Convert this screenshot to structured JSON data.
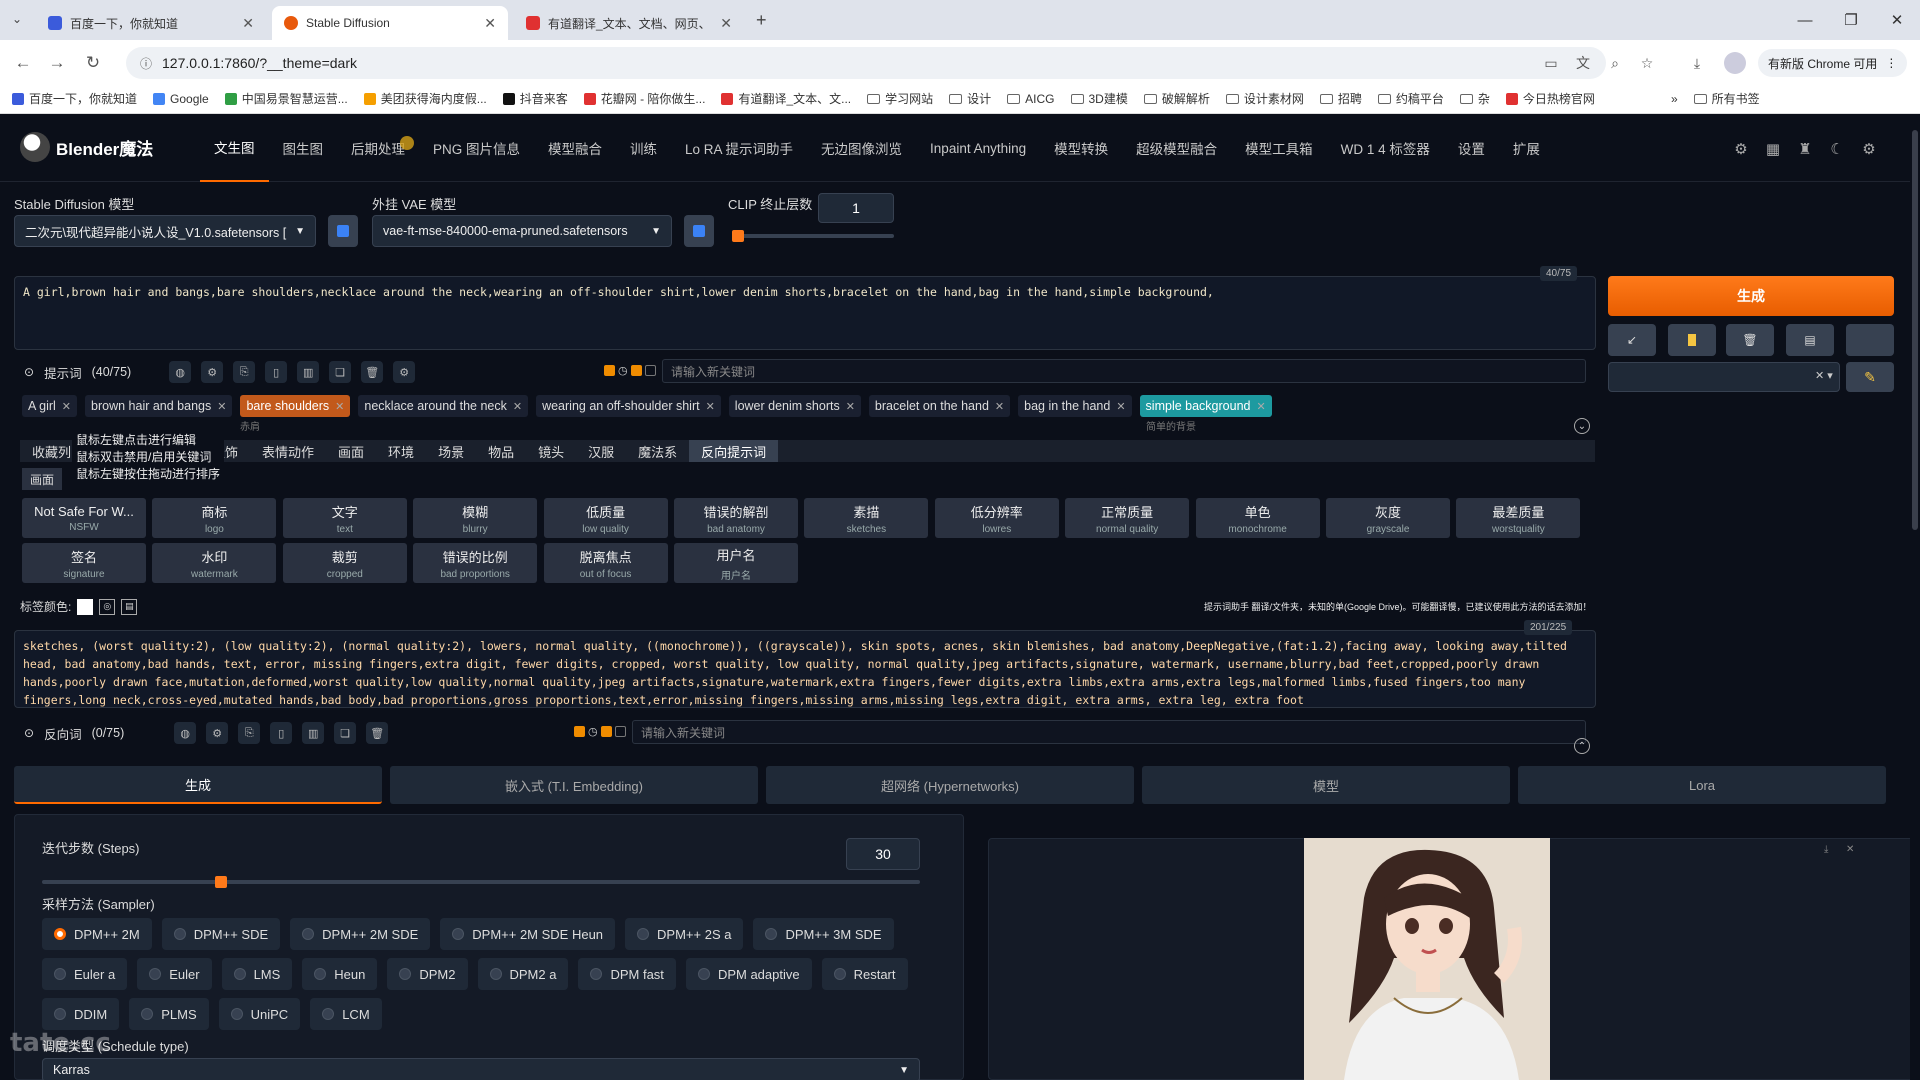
{
  "browser": {
    "tabs": [
      {
        "title": "百度一下，你就知道",
        "active": false
      },
      {
        "title": "Stable Diffusion",
        "active": true
      },
      {
        "title": "有道翻译_文本、文档、网页、",
        "active": false
      }
    ],
    "url": "127.0.0.1:7860/?__theme=dark",
    "chrome_pill": "有新版 Chrome 可用",
    "bookmarks": [
      "百度一下，你就知道",
      "Google",
      "中国易景智慧运营...",
      "美团获得海内度假...",
      "抖音来客",
      "花瓣网 - 陪你做生...",
      "有道翻译_文本、文...",
      "学习网站",
      "设计",
      "AICG",
      "3D建模",
      "破解解析",
      "设计素材网",
      "招聘",
      "约稿平台",
      "杂",
      "今日热榜官网"
    ],
    "all_bookmarks": "所有书签"
  },
  "app": {
    "logo": "Blender魔法",
    "menu": [
      "文生图",
      "图生图",
      "后期处理",
      "PNG 图片信息",
      "模型融合",
      "训练",
      "Lo RA 提示词助手",
      "无边图像浏览",
      "Inpaint Anything",
      "模型转换",
      "超级模型融合",
      "模型工具箱",
      "WD 1 4 标签器",
      "设置",
      "扩展"
    ],
    "sd_model_label": "Stable Diffusion 模型",
    "sd_model_value": "二次元\\现代超异能小说人设_V1.0.safetensors [",
    "vae_label": "外挂 VAE 模型",
    "vae_value": "vae-ft-mse-840000-ema-pruned.safetensors",
    "clip_label": "CLIP 终止层数",
    "clip_value": "1",
    "clip_slider_fraction": 0.0
  },
  "prompt": {
    "text": "A girl,brown hair and bangs,bare shoulders,necklace around the neck,wearing an off-shoulder shirt,lower denim shorts,bracelet on the hand,bag in the hand,simple background,",
    "counter": "40/75",
    "header_label": "提示词",
    "header_count": "(40/75)",
    "keyword_placeholder": "请输入新关键词",
    "tags": [
      {
        "text": "A girl",
        "style": "plain"
      },
      {
        "text": "brown hair and bangs",
        "style": "plain"
      },
      {
        "text": "bare shoulders",
        "style": "orange"
      },
      {
        "text": "necklace around the neck",
        "style": "plain"
      },
      {
        "text": "wearing an off-shoulder shirt",
        "style": "plain"
      },
      {
        "text": "lower denim shorts",
        "style": "plain"
      },
      {
        "text": "bracelet on the hand",
        "style": "plain"
      },
      {
        "text": "bag in the hand",
        "style": "plain"
      },
      {
        "text": "simple background",
        "style": "teal"
      }
    ],
    "subtags": [
      "赤肩",
      "简单的背景"
    ]
  },
  "tooltip": [
    "鼠标左键点击进行编辑",
    "鼠标双击禁用/启用关键词",
    "鼠标左键按住拖动进行排序"
  ],
  "categories": [
    "收藏列",
    "服饰",
    "表情动作",
    "画面",
    "环境",
    "场景",
    "物品",
    "镜头",
    "汉服",
    "魔法系",
    "反向提示词"
  ],
  "sub_category": "画面",
  "neg_grid": [
    {
      "cn": "Not Safe For W...",
      "en": "NSFW"
    },
    {
      "cn": "商标",
      "en": "logo"
    },
    {
      "cn": "文字",
      "en": "text"
    },
    {
      "cn": "模糊",
      "en": "blurry"
    },
    {
      "cn": "低质量",
      "en": "low quality"
    },
    {
      "cn": "错误的解剖",
      "en": "bad anatomy"
    },
    {
      "cn": "素描",
      "en": "sketches"
    },
    {
      "cn": "低分辨率",
      "en": "lowres"
    },
    {
      "cn": "正常质量",
      "en": "normal quality"
    },
    {
      "cn": "单色",
      "en": "monochrome"
    },
    {
      "cn": "灰度",
      "en": "grayscale"
    },
    {
      "cn": "最差质量",
      "en": "worstquality"
    },
    {
      "cn": "签名",
      "en": "signature"
    },
    {
      "cn": "水印",
      "en": "watermark"
    },
    {
      "cn": "裁剪",
      "en": "cropped"
    },
    {
      "cn": "错误的比例",
      "en": "bad proportions"
    },
    {
      "cn": "脱离焦点",
      "en": "out of focus"
    },
    {
      "cn": "用户名",
      "en": "用户名"
    }
  ],
  "tag_color_label": "标签颜色:",
  "notice": "提示词助手 翻译/文件夹，未知的单(Google Drive)。可能翻译慢，已建议使用此方法的话去添加！",
  "negative": {
    "text": "sketches, (worst quality:2), (low quality:2), (normal quality:2), lowers, normal quality, ((monochrome)), ((grayscale)), skin spots, acnes, skin blemishes, bad anatomy,DeepNegative,(fat:1.2),facing away, looking away,tilted head, bad anatomy,bad hands, text, error, missing fingers,extra digit, fewer digits, cropped, worst quality, low quality, normal quality,jpeg artifacts,signature, watermark, username,blurry,bad feet,cropped,poorly drawn hands,poorly drawn face,mutation,deformed,worst quality,low quality,normal quality,jpeg artifacts,signature,watermark,extra fingers,fewer digits,extra limbs,extra arms,extra legs,malformed limbs,fused fingers,too many fingers,long neck,cross-eyed,mutated hands,bad body,bad proportions,gross proportions,text,error,missing fingers,missing arms,missing legs,extra digit, extra arms, extra leg, extra foot",
    "counter": "201/225",
    "header_label": "反向词",
    "header_count": "(0/75)",
    "keyword_placeholder": "请输入新关键词"
  },
  "generate_label": "生成",
  "bottom_tabs": [
    "生成",
    "嵌入式 (T.I. Embedding)",
    "超网络 (Hypernetworks)",
    "模型",
    "Lora"
  ],
  "steps": {
    "label": "迭代步数 (Steps)",
    "value": "30",
    "fraction": 0.2
  },
  "sampler": {
    "label": "采样方法 (Sampler)",
    "selected": "DPM++ 2M",
    "options": [
      "DPM++ 2M",
      "DPM++ SDE",
      "DPM++ 2M SDE",
      "DPM++ 2M SDE Heun",
      "DPM++ 2S a",
      "DPM++ 3M SDE",
      "Euler a",
      "Euler",
      "LMS",
      "Heun",
      "DPM2",
      "DPM2 a",
      "DPM fast",
      "DPM adaptive",
      "Restart",
      "DDIM",
      "PLMS",
      "UniPC",
      "LCM"
    ]
  },
  "schedule": {
    "label": "调度类型 (Schedule type)",
    "value": "Karras"
  },
  "watermark": "tate.cc"
}
